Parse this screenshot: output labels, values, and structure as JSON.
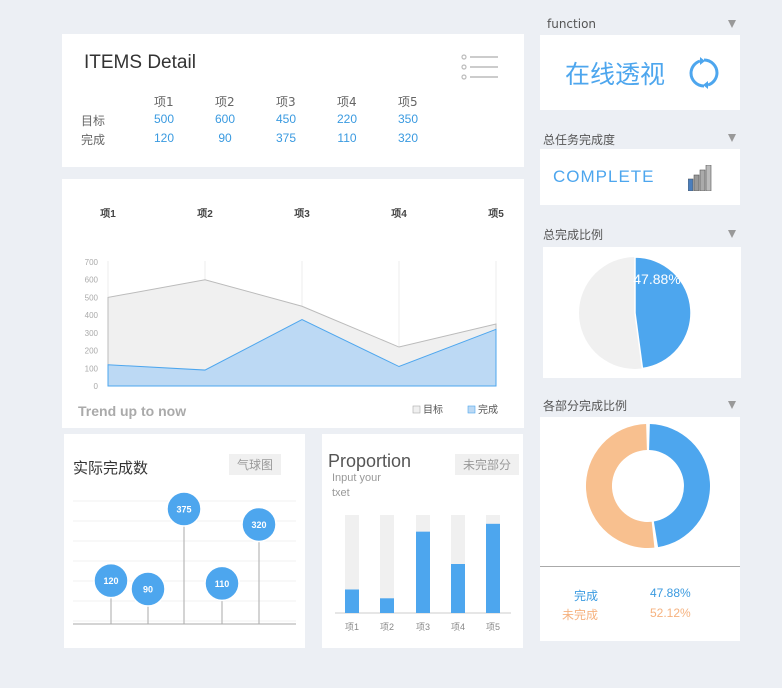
{
  "items_detail": {
    "title": "ITEMS Detail",
    "columns": [
      "项1",
      "项2",
      "项3",
      "项4",
      "项5"
    ],
    "rows": [
      {
        "label": "目标",
        "values": [
          "500",
          "600",
          "450",
          "220",
          "350"
        ]
      },
      {
        "label": "完成",
        "values": [
          "120",
          "90",
          "375",
          "110",
          "320"
        ]
      }
    ]
  },
  "trend": {
    "top_labels": [
      "项1",
      "项2",
      "项3",
      "项4",
      "项5"
    ],
    "footer_title": "Trend up to now",
    "legend": [
      "目标",
      "完成"
    ]
  },
  "actual": {
    "title": "实际完成数",
    "tag": "气球图"
  },
  "proportion": {
    "title": "Proportion",
    "subtitle_line1": "Input your",
    "subtitle_line2": "txet",
    "tag": "未完部分"
  },
  "sidebar": {
    "function_title": "function",
    "function_label": "在线透视",
    "task_title": "总任务完成度",
    "complete_label": "COMPLETE",
    "ratio_title": "总完成比例",
    "ratio_value": "47.88%",
    "part_title": "各部分完成比例",
    "legend": [
      {
        "label": "完成",
        "value": "47.88%"
      },
      {
        "label": "未完成",
        "value": "52.12%"
      }
    ]
  },
  "colors": {
    "blue": "#4da6ee",
    "orange": "#f8c08f",
    "gray": "#f0f0f0"
  },
  "chart_data": [
    {
      "type": "area",
      "categories": [
        "项1",
        "项2",
        "项3",
        "项4",
        "项5"
      ],
      "series": [
        {
          "name": "目标",
          "values": [
            500,
            600,
            450,
            220,
            350
          ]
        },
        {
          "name": "完成",
          "values": [
            120,
            90,
            375,
            110,
            320
          ]
        }
      ],
      "ylim": [
        0,
        700
      ],
      "yticks": [
        0,
        100,
        200,
        300,
        400,
        500,
        600,
        700
      ],
      "legend_position": "bottom-right",
      "grid": false
    },
    {
      "type": "scatter",
      "categories": [
        "1",
        "2",
        "3",
        "4",
        "5"
      ],
      "values": [
        120,
        90,
        375,
        110,
        320
      ]
    },
    {
      "type": "bar",
      "categories": [
        "项1",
        "项2",
        "项3",
        "项4",
        "项5"
      ],
      "series": [
        {
          "name": "目标",
          "values": [
            500,
            600,
            450,
            220,
            350
          ]
        },
        {
          "name": "完成",
          "values": [
            120,
            90,
            375,
            110,
            320
          ]
        }
      ],
      "stacked_percent": true,
      "bar_ratios": [
        0.24,
        0.15,
        0.83,
        0.5,
        0.91
      ]
    },
    {
      "type": "pie",
      "labels": [
        "完成",
        "未完成"
      ],
      "values": [
        47.88,
        52.12
      ]
    },
    {
      "type": "pie",
      "donut": true,
      "labels": [
        "完成",
        "未完成"
      ],
      "values": [
        47.88,
        52.12
      ]
    }
  ]
}
